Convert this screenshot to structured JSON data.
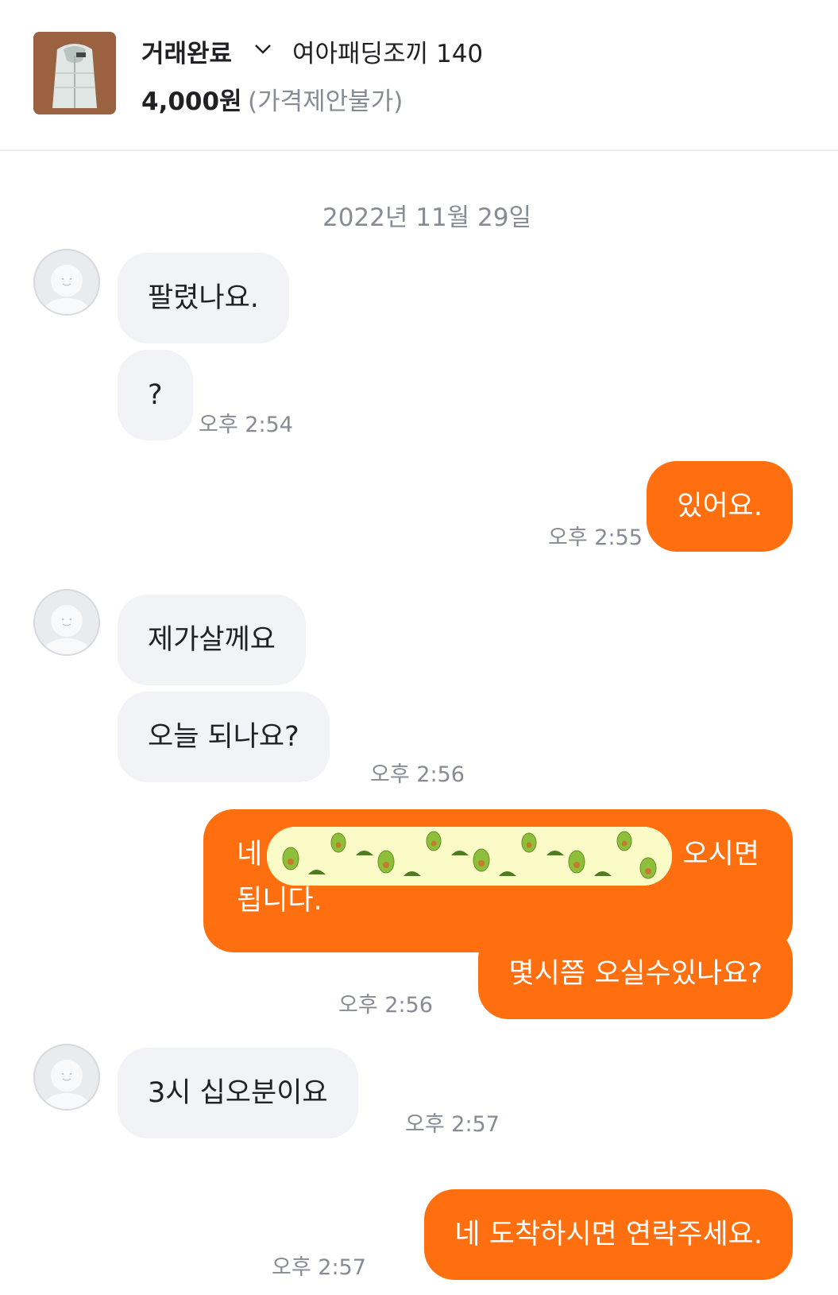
{
  "header": {
    "status": "거래완료",
    "product_title": "여아패딩조끼 140",
    "price": "4,000원",
    "price_note": "(가격제안불가)"
  },
  "date_divider": "2022년 11월 29일",
  "messages": [
    {
      "from": "other",
      "text": "팔렸나요."
    },
    {
      "from": "other",
      "text": "?",
      "time": "오후 2:54"
    },
    {
      "from": "me",
      "text": "있어요.",
      "time": "오후 2:55"
    },
    {
      "from": "other",
      "text": "제가살께요"
    },
    {
      "from": "other",
      "text": "오늘 되나요?",
      "time": "오후 2:56"
    },
    {
      "from": "me",
      "line1": "네",
      "line1_end": "오시면",
      "line2": "됩니다."
    },
    {
      "from": "me",
      "text": "몇시쯤 오실수있나요?",
      "time": "오후 2:56"
    },
    {
      "from": "other",
      "text": "3시 십오분이요",
      "time": "오후 2:57"
    },
    {
      "from": "me",
      "text": "네 도착하시면 연락주세요.",
      "time": "오후 2:57"
    }
  ],
  "colors": {
    "accent": "#ff6f0f",
    "incoming_bubble": "#f2f3f6",
    "muted_text": "#868b94"
  },
  "icons": {
    "dropdown": "chevron-down-icon",
    "avatar": "default-profile-icon"
  }
}
